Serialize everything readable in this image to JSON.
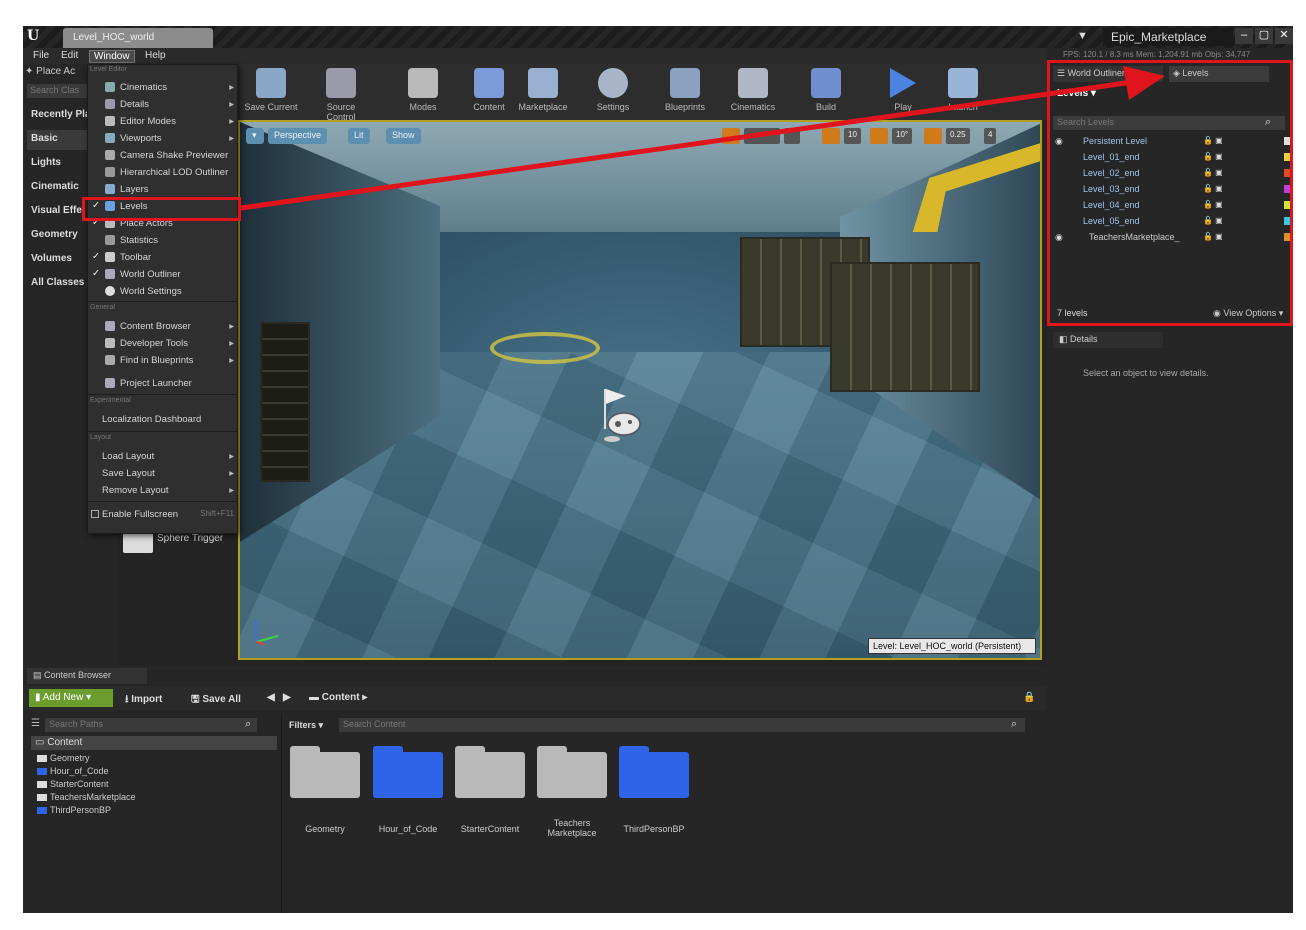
{
  "titlebar": {
    "level_tab": "Level_HOC_world",
    "project": "Epic_Marketplace",
    "minimize": "–",
    "maximize": "▢",
    "close": "✕"
  },
  "menubar": {
    "file": "File",
    "edit": "Edit",
    "window": "Window",
    "help": "Help"
  },
  "modes": {
    "tab": "Place Ac",
    "search_placeholder": "Search Clas",
    "categories": [
      "Recently Pla",
      "Basic",
      "Lights",
      "Cinematic",
      "Visual Effe",
      "Geometry",
      "Volumes",
      "All Classes"
    ]
  },
  "window_menu": {
    "section_level_editor": "Level Editor",
    "cinematics": "Cinematics",
    "details": "Details",
    "editor_modes": "Editor Modes",
    "viewports": "Viewports",
    "camera_shake": "Camera Shake Previewer",
    "hlod": "Hierarchical LOD Outliner",
    "layers": "Layers",
    "levels": "Levels",
    "place_actors": "Place Actors",
    "statistics": "Statistics",
    "toolbar": "Toolbar",
    "world_outliner": "World Outliner",
    "world_settings": "World Settings",
    "section_general": "General",
    "content_browser": "Content Browser",
    "developer_tools": "Developer Tools",
    "find_in_blueprints": "Find in Blueprints",
    "project_launcher": "Project Launcher",
    "section_experimental": "Experimental",
    "localization_dashboard": "Localization Dashboard",
    "section_layout": "Layout",
    "load_layout": "Load Layout",
    "save_layout": "Save Layout",
    "remove_layout": "Remove Layout",
    "enable_fullscreen": "Enable Fullscreen",
    "fullscreen_shortcut": "Shift+F11",
    "sphere_trigger": "Sphere Trigger"
  },
  "toolbar": {
    "save_current": "Save Current",
    "source_control": "Source Control",
    "modes": "Modes",
    "content": "Content",
    "marketplace": "Marketplace",
    "settings": "Settings",
    "blueprints": "Blueprints",
    "cinematics": "Cinematics",
    "build": "Build",
    "play": "Play",
    "launch": "Launch"
  },
  "viewport": {
    "perspective": "Perspective",
    "lit": "Lit",
    "show": "Show",
    "grid_snap": "10",
    "rot_snap": "10°",
    "scale_snap": "0.25",
    "cam_speed": "4",
    "level_label": "Level:  Level_HOC_world (Persistent)"
  },
  "right_panel": {
    "perf": "FPS: 120.1  /  8.3 ms  Mem: 1,204.91 mb  Objs: 34,747",
    "tab_world_outliner": "World Outliner",
    "tab_levels": "Levels",
    "levels_dropdown": "Levels ▾",
    "search_placeholder": "Search Levels",
    "levels": [
      {
        "name": "Persistent Level",
        "color": "#e0e0e0"
      },
      {
        "name": "Level_01_end",
        "color": "#e8d23a"
      },
      {
        "name": "Level_02_end",
        "color": "#e04a2a"
      },
      {
        "name": "Level_03_end",
        "color": "#c83ad8"
      },
      {
        "name": "Level_04_end",
        "color": "#d8e03a"
      },
      {
        "name": "Level_05_end",
        "color": "#3ac8e0"
      },
      {
        "name": "TeachersMarketplace_",
        "color": "#e0902a"
      }
    ],
    "levels_count": "7 levels",
    "view_options": "View Options ▾",
    "details_tab": "Details",
    "details_msg": "Select an object to view details."
  },
  "content_browser": {
    "tab": "Content Browser",
    "add_new": "Add New ▾",
    "import": "Import",
    "save_all": "Save All",
    "path": "Content",
    "search_paths_placeholder": "Search Paths",
    "filters": "Filters ▾",
    "search_content_placeholder": "Search Content",
    "tree_root": "Content",
    "tree": [
      "Geometry",
      "Hour_of_Code",
      "StarterContent",
      "TeachersMarketplace",
      "ThirdPersonBP"
    ],
    "folders": [
      {
        "name": "Geometry",
        "color": "#b9b9b9"
      },
      {
        "name": "Hour_of_Code",
        "color": "#2f63e8"
      },
      {
        "name": "StarterContent",
        "color": "#b9b9b9"
      },
      {
        "name": "Teachers\nMarketplace",
        "color": "#b9b9b9"
      },
      {
        "name": "ThirdPersonBP",
        "color": "#2f63e8"
      }
    ]
  },
  "colors": {
    "highlight": "#e0141c",
    "viewport_border": "#b3a021",
    "add_new": "#6a9d2d"
  }
}
